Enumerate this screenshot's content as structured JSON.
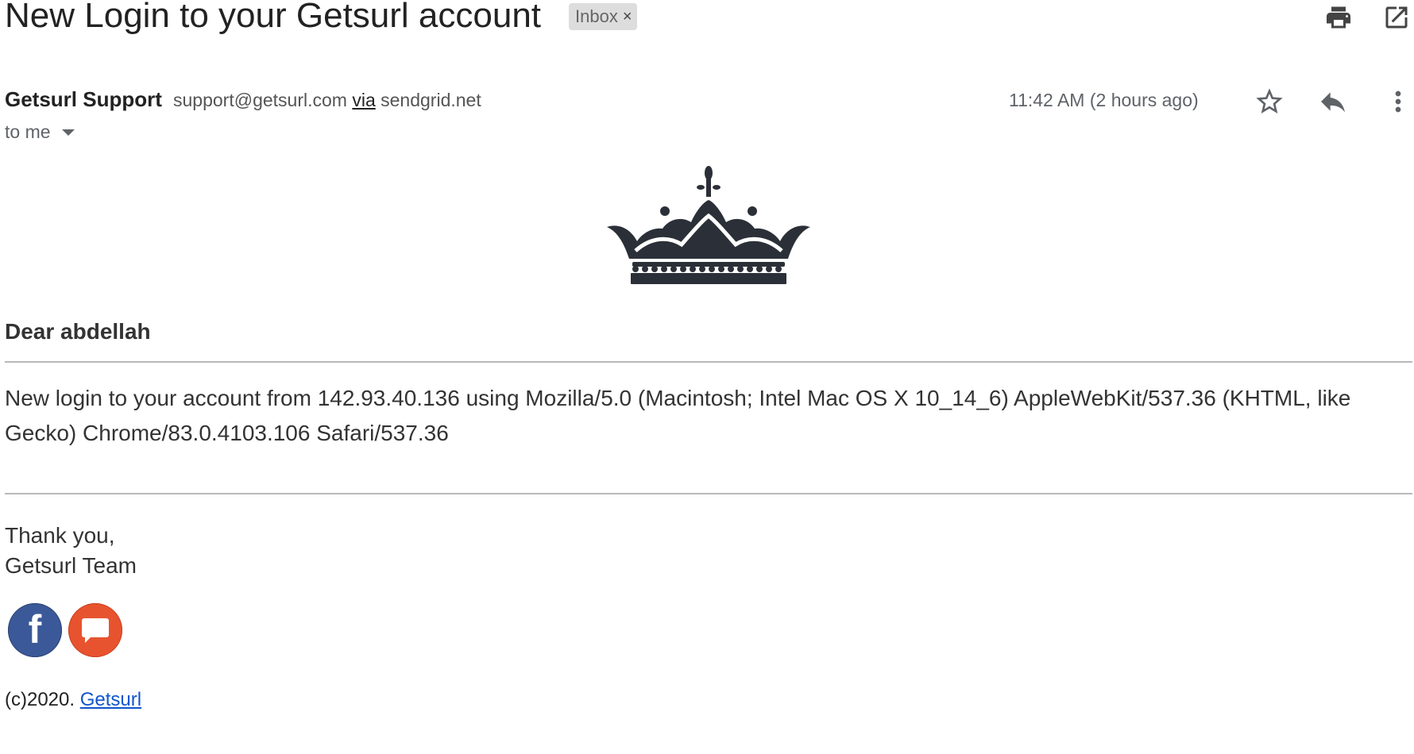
{
  "email": {
    "subject": "New Login to your Getsurl account",
    "label": "Inbox",
    "label_remove": "×"
  },
  "toolbar": {
    "print_icon": "print-icon",
    "popout_icon": "open-in-new-window-icon"
  },
  "sender": {
    "name": "Getsurl Support",
    "email": "support@getsurl.com",
    "via_word": "via",
    "via_domain": "sendgrid.net",
    "recipient": "to me",
    "timestamp": "11:42 AM (2 hours ago)"
  },
  "message_actions": {
    "star_icon": "star-icon",
    "reply_icon": "reply-icon",
    "more_icon": "more-vert-icon"
  },
  "body": {
    "logo_icon": "crown-icon",
    "greeting": "Dear abdellah",
    "paragraph": "New login to your account from 142.93.40.136 using Mozilla/5.0 (Macintosh; Intel Mac OS X 10_14_6) AppleWebKit/537.36 (KHTML, like Gecko) Chrome/83.0.4103.106 Safari/537.36",
    "signoff_line1": "Thank you,",
    "signoff_line2": "Getsurl Team",
    "social": [
      "facebook-icon",
      "chat-icon"
    ],
    "footer_prefix": "(c)2020.",
    "footer_link": "Getsurl"
  },
  "colors": {
    "link": "#1155cc",
    "facebook": "#3b5998",
    "chat": "#e8532f",
    "icon": "#5f6368",
    "crown": "#2b3038"
  }
}
